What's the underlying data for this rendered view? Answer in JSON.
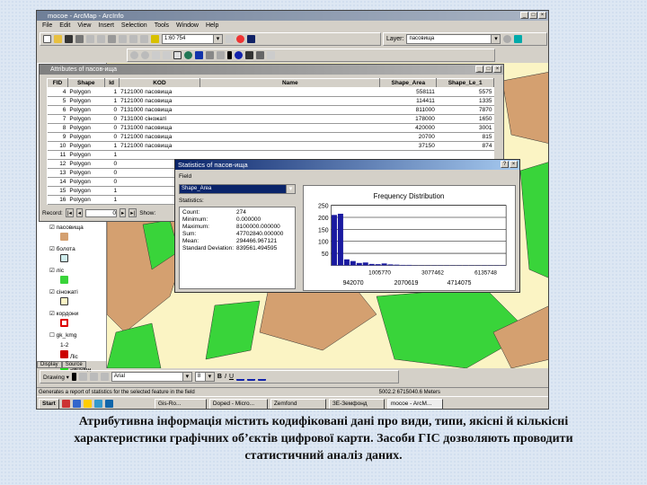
{
  "window": {
    "title": "mocoe - ArcMap - ArcInfo"
  },
  "menu": [
    "File",
    "Edit",
    "View",
    "Insert",
    "Selection",
    "Tools",
    "Window",
    "Help"
  ],
  "toolbar": {
    "scale": "1:60 754",
    "layer_label": "Layer:",
    "layer": "пасовища",
    "font": "Arial",
    "font_size": "8",
    "drawing": "Drawing ▾"
  },
  "attributes": {
    "title": "Attributes of пасов-ища",
    "columns": [
      "FID",
      "Shape",
      "Id",
      "KOD",
      "Name",
      "Shape_Area",
      "Shape_Le_1"
    ],
    "rows": [
      [
        "4",
        "Polygon",
        "1",
        "7121000 пасовища",
        "",
        "558111",
        "5575"
      ],
      [
        "5",
        "Polygon",
        "1",
        "7121000 пасовища",
        "",
        "114411",
        "1335"
      ],
      [
        "6",
        "Polygon",
        "0",
        "7131000 пасовища",
        "",
        "811000",
        "7870"
      ],
      [
        "7",
        "Polygon",
        "0",
        "7131000 сіножаті",
        "",
        "178000",
        "1650"
      ],
      [
        "8",
        "Polygon",
        "0",
        "7131000 пасовища",
        "",
        "420000",
        "3001"
      ],
      [
        "9",
        "Polygon",
        "0",
        "7121000 пасовища",
        "",
        "20700",
        "815"
      ],
      [
        "10",
        "Polygon",
        "1",
        "7121000 пасовища",
        "",
        "37150",
        "874"
      ],
      [
        "11",
        "Polygon",
        "1",
        "",
        "",
        "",
        ""
      ],
      [
        "12",
        "Polygon",
        "0",
        "",
        "",
        "",
        ""
      ],
      [
        "13",
        "Polygon",
        "0",
        "",
        "",
        "",
        ""
      ],
      [
        "14",
        "Polygon",
        "0",
        "",
        "",
        "",
        ""
      ],
      [
        "15",
        "Polygon",
        "1",
        "",
        "",
        "",
        ""
      ],
      [
        "16",
        "Polygon",
        "1",
        "",
        "",
        "",
        ""
      ]
    ],
    "record_label": "Record:",
    "record_value": "0",
    "show_label": "Show:"
  },
  "toc": {
    "layers": [
      "пасовища",
      "болота",
      "ліс",
      "сіножаті",
      "кордони",
      "gk_kmg"
    ],
    "legend": [
      "1-2",
      "Ліс",
      "Заповід"
    ],
    "tabs": [
      "Display",
      "Source"
    ]
  },
  "stats": {
    "title": "Statistics of пасов-ища",
    "field_label": "Field",
    "field": "Shape_Area",
    "statistics_label": "Statistics:",
    "items": [
      [
        "Count:",
        "274"
      ],
      [
        "Minimum:",
        "0.000000"
      ],
      [
        "Maximum:",
        "8100000.000000"
      ],
      [
        "Sum:",
        "47702840.000000"
      ],
      [
        "Mean:",
        "294466.967121"
      ],
      [
        "Standard Deviation:",
        "839561.494595"
      ]
    ]
  },
  "chart_data": {
    "type": "bar",
    "title": "Frequency Distribution",
    "ylim": [
      0,
      250
    ],
    "yticks": [
      "250",
      "200",
      "150",
      "100",
      "50"
    ],
    "values": [
      210,
      215,
      25,
      18,
      10,
      12,
      6,
      5,
      8,
      4,
      3,
      2,
      2,
      1,
      1,
      1,
      1,
      1,
      1,
      1,
      1,
      1,
      1,
      1,
      1,
      1,
      1,
      1
    ],
    "xticks_upper": [
      "1005770",
      "3077462",
      "6135748"
    ],
    "xticks_lower": [
      "942070",
      "2070619",
      "4714075"
    ]
  },
  "status": {
    "left": "Generates a report of statistics for the selected feature in the field",
    "right": "5002.2  6715040.6  Meters"
  },
  "taskbar": {
    "start": "Start",
    "items": [
      "Gis-Ro...",
      "Doped - Micro...",
      "Zemfond",
      "ЗЕ-Земфонд",
      "mocoe - ArcM..."
    ]
  },
  "caption": [
    "Атрибутивна інформація містить кодифіковані дані про види, типи, якісні й кількісні",
    "характеристики графічних об’єктів цифрової карти. Засоби ГІС дозволяють проводити",
    "статистичний аналіз даних."
  ]
}
